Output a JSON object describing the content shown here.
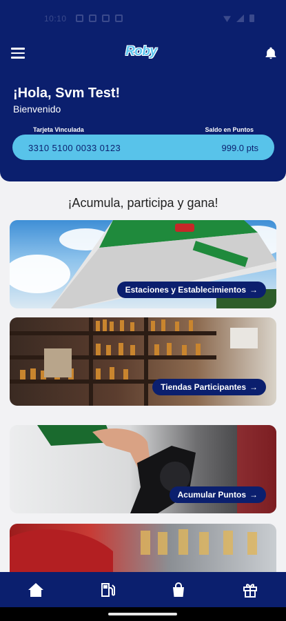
{
  "status_bar": {
    "time": "10:10"
  },
  "header": {
    "logo_text": "Roby",
    "greeting": "¡Hola, Svm Test!",
    "welcome": "Bienvenido"
  },
  "card": {
    "label_left": "Tarjeta Vinculada",
    "label_right": "Saldo en Puntos",
    "number": "3310 5100 0033 0123",
    "points": "999.0 pts"
  },
  "tagline": "¡Acumula, participa y gana!",
  "promos": [
    {
      "label": "Estaciones y Establecimientos",
      "arrow": "→"
    },
    {
      "label": "Tiendas Participantes",
      "arrow": "→"
    },
    {
      "label": "Acumular Puntos",
      "arrow": "→"
    }
  ],
  "nav": [
    "home-icon",
    "fuel-pump-icon",
    "shopping-bag-icon",
    "gift-icon"
  ],
  "colors": {
    "primary": "#0b1f6e",
    "accent": "#58c3ea",
    "background": "#f2f2f4"
  }
}
